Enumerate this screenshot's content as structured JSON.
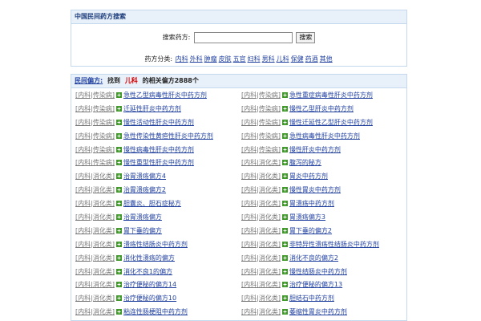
{
  "search_box": {
    "title": "中国民间药方搜索",
    "label": "搜索药方:",
    "input_value": "",
    "button_label": "搜索",
    "categories_label": "药方分类:",
    "categories": [
      "内科",
      "外科",
      "肿瘤",
      "皮肤",
      "五官",
      "妇科",
      "男科",
      "儿科",
      "保健",
      "药酒",
      "其他"
    ]
  },
  "results": {
    "prefix": "民间偏方:",
    "found_text": "找到",
    "keyword": "儿科",
    "suffix": "的相关偏方2888个",
    "items": [
      {
        "category": "[内科|传染病]",
        "title": "急性乙型病毒性肝炎中药方剂"
      },
      {
        "category": "[内科|传染病]",
        "title": "急性重症病毒性肝炎中药方剂"
      },
      {
        "category": "[内科|传染病]",
        "title": "迁延性肝炎中药方剂"
      },
      {
        "category": "[内科|传染病]",
        "title": "慢性乙型肝炎中药方剂"
      },
      {
        "category": "[内科|传染病]",
        "title": "慢性活动性肝炎中药方剂"
      },
      {
        "category": "[内科|传染病]",
        "title": "慢性迁延性乙型肝炎中药方剂"
      },
      {
        "category": "[内科|传染病]",
        "title": "急性传染性黄疸性肝炎中药方剂"
      },
      {
        "category": "[内科|传染病]",
        "title": "急性病毒性肝炎中药方剂"
      },
      {
        "category": "[内科|传染病]",
        "title": "慢性病毒性肝炎中药方剂"
      },
      {
        "category": "[内科|传染病]",
        "title": "慢性肝炎中药方剂"
      },
      {
        "category": "[内科|传染病]",
        "title": "慢性重型性肝炎中药方剂"
      },
      {
        "category": "[内科|消化类]",
        "title": "腹泻的秘方"
      },
      {
        "category": "[内科|消化类]",
        "title": "治胃溃疡偏方4"
      },
      {
        "category": "[内科|消化类]",
        "title": "胃炎中药方剂"
      },
      {
        "category": "[内科|消化类]",
        "title": "治胃溃疡偏方2"
      },
      {
        "category": "[内科|消化类]",
        "title": "慢性胃炎中药方剂"
      },
      {
        "category": "[内科|消化类]",
        "title": "胆囊炎、胆石症秘方"
      },
      {
        "category": "[内科|消化类]",
        "title": "胃溃疡中药方剂"
      },
      {
        "category": "[内科|消化类]",
        "title": "治胃溃疡偏方"
      },
      {
        "category": "[内科|消化类]",
        "title": "胃溃疡偏方3"
      },
      {
        "category": "[内科|消化类]",
        "title": "胃下垂的偏方"
      },
      {
        "category": "[内科|消化类]",
        "title": "胃下垂的偏方2"
      },
      {
        "category": "[内科|消化类]",
        "title": "溃疡性结肠炎中药方剂"
      },
      {
        "category": "[内科|消化类]",
        "title": "非特异性溃疡性结肠炎中药方剂"
      },
      {
        "category": "[内科|消化类]",
        "title": "消化性溃疡的偏方"
      },
      {
        "category": "[内科|消化类]",
        "title": "消化不良的偏方2"
      },
      {
        "category": "[内科|消化类]",
        "title": "消化不良1的偏方"
      },
      {
        "category": "[内科|消化类]",
        "title": "慢性结肠炎中药方剂"
      },
      {
        "category": "[内科|消化类]",
        "title": "治疗便秘的偏方14"
      },
      {
        "category": "[内科|消化类]",
        "title": "治疗便秘的偏方13"
      },
      {
        "category": "[内科|消化类]",
        "title": "治疗便秘的偏方10"
      },
      {
        "category": "[内科|消化类]",
        "title": "胆结石中药方剂"
      },
      {
        "category": "[内科|消化类]",
        "title": "粘连性肠梗阻中药方剂"
      },
      {
        "category": "[内科|消化类]",
        "title": "萎缩性胃炎中药方剂"
      }
    ]
  },
  "icons": {
    "item_icon": "green-plus-square-icon"
  },
  "colors": {
    "link": "#1f3f9f",
    "keyword": "#d40000",
    "category_text": "#777777",
    "header_bg": "#e8f1fa",
    "border": "#c5d9ee",
    "icon_green": "#3f9a2a"
  }
}
